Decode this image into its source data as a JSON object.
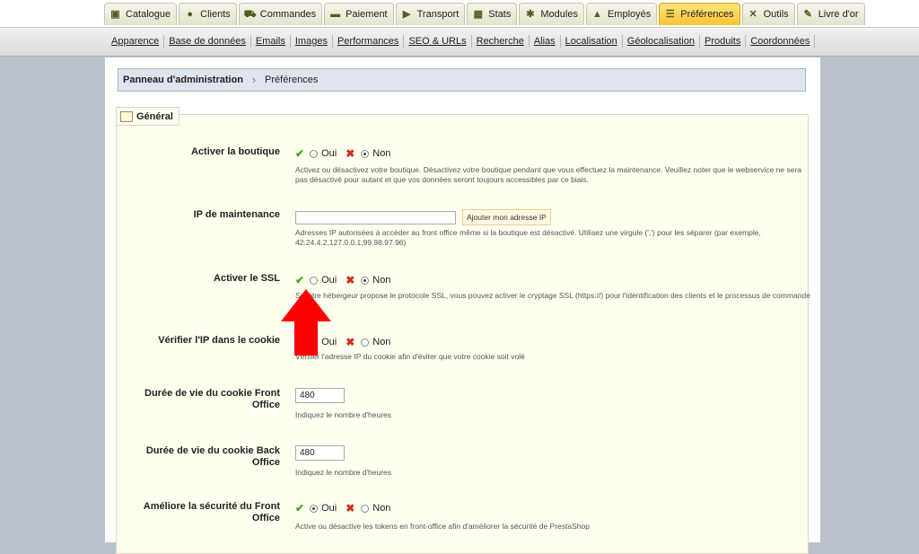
{
  "tabs": [
    {
      "label": "Catalogue",
      "icon": "catalog-icon",
      "active": false
    },
    {
      "label": "Clients",
      "icon": "clients-icon",
      "active": false
    },
    {
      "label": "Commandes",
      "icon": "cart-icon",
      "active": false
    },
    {
      "label": "Paiement",
      "icon": "payment-icon",
      "active": false
    },
    {
      "label": "Transport",
      "icon": "truck-icon",
      "active": false
    },
    {
      "label": "Stats",
      "icon": "stats-icon",
      "active": false
    },
    {
      "label": "Modules",
      "icon": "modules-icon",
      "active": false
    },
    {
      "label": "Employés",
      "icon": "employees-icon",
      "active": false
    },
    {
      "label": "Préférences",
      "icon": "preferences-icon",
      "active": true
    },
    {
      "label": "Outils",
      "icon": "tools-icon",
      "active": false
    },
    {
      "label": "Livre d'or",
      "icon": "guestbook-icon",
      "active": false
    }
  ],
  "subnav": [
    "Apparence",
    "Base de données",
    "Emails",
    "Images",
    "Performances",
    "SEO & URLs",
    "Recherche",
    "Alias",
    "Localisation",
    "Géolocalisation",
    "Produits",
    "Coordonnées"
  ],
  "breadcrumb": {
    "root": "Panneau d'administration",
    "separator": "›",
    "current": "Préférences"
  },
  "fieldset": {
    "legend": "Général"
  },
  "labels": {
    "yes": "Oui",
    "no": "Non"
  },
  "fields": {
    "shop_enable": {
      "label": "Activer la boutique",
      "value": "Non",
      "hint": "Activez ou désactivez votre boutique. Désactivez votre boutique pendant que vous effectuez la maintenance. Veuillez noter que le webservice ne sera pas désactivé pour autant et que vos données seront toujours accessibles par ce biais."
    },
    "maintenance_ip": {
      "label": "IP de maintenance",
      "value": "",
      "button": "Ajouter mon adresse IP",
      "hint": "Adresses IP autorisées à accéder au front office même si la boutique est désactivé. Utilisez une virgule (',') pour les séparer (par exemple, 42.24.4.2,127.0.0.1,99.98.97.96)"
    },
    "ssl_enable": {
      "label": "Activer le SSL",
      "value": "Non",
      "hint": "Si votre hébergeur propose le protocole SSL, vous pouvez activer le cryptage SSL (https://) pour l'identification des clients et le processus de commande"
    },
    "cookie_ip_check": {
      "label": "Vérifier l'IP dans le cookie",
      "value": "Non",
      "hint": "Vérifier l'adresse IP du cookie afin d'éviter que votre cookie soit volé"
    },
    "cookie_front": {
      "label": "Durée de vie du cookie Front Office",
      "value": "480",
      "hint": "Indiquez le nombre d'heures"
    },
    "cookie_back": {
      "label": "Durée de vie du cookie Back Office",
      "value": "480",
      "hint": "Indiquez le nombre d'heures"
    },
    "front_security": {
      "label": "Améliore la sécurité du Front Office",
      "value": "Oui",
      "hint": "Active ou désactive les tokens en front-office afin d'améliorer la sécurité de PrestaShop"
    }
  },
  "colors": {
    "active_tab": "#fac534",
    "arrow": "#ff0000",
    "fieldset_bg": "#fffff0"
  }
}
